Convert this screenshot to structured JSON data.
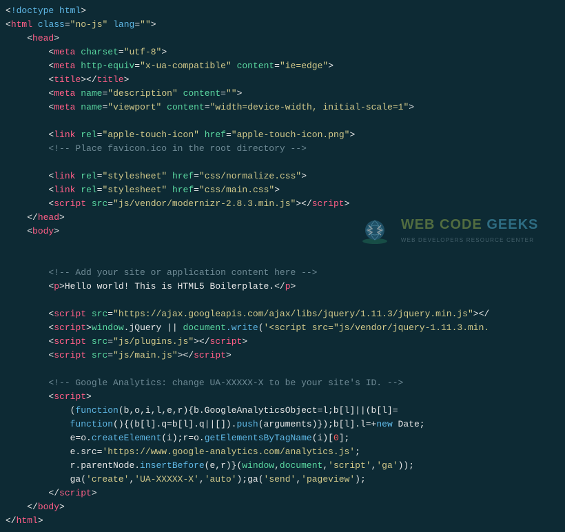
{
  "doctype": "!doctype html",
  "html_open": {
    "tag": "html",
    "cls_attr": "class",
    "cls_val": "no-js",
    "lang_attr": "lang",
    "lang_val": ""
  },
  "head": "head",
  "meta_charset": {
    "tag": "meta",
    "attr": "charset",
    "val": "utf-8"
  },
  "meta_http": {
    "tag": "meta",
    "a1": "http-equiv",
    "v1": "x-ua-compatible",
    "a2": "content",
    "v2": "ie=edge"
  },
  "title_tag": "title",
  "meta_desc": {
    "tag": "meta",
    "a1": "name",
    "v1": "description",
    "a2": "content",
    "v2": ""
  },
  "meta_vp": {
    "tag": "meta",
    "a1": "name",
    "v1": "viewport",
    "a2": "content",
    "v2": "width=device-width, initial-scale=1"
  },
  "link_touch": {
    "tag": "link",
    "a1": "rel",
    "v1": "apple-touch-icon",
    "a2": "href",
    "v2": "apple-touch-icon.png"
  },
  "cmt_favicon": "<!-- Place favicon.ico in the root directory -->",
  "link_norm": {
    "tag": "link",
    "a1": "rel",
    "v1": "stylesheet",
    "a2": "href",
    "v2": "css/normalize.css"
  },
  "link_main": {
    "tag": "link",
    "a1": "rel",
    "v1": "stylesheet",
    "a2": "href",
    "v2": "css/main.css"
  },
  "script_modernizr": {
    "tag": "script",
    "a1": "src",
    "v1": "js/vendor/modernizr-2.8.3.min.js"
  },
  "body": "body",
  "cmt_content": "<!-- Add your site or application content here -->",
  "p": {
    "tag": "p",
    "text": "Hello world! This is HTML5 Boilerplate."
  },
  "script_jq_cdn": {
    "tag": "script",
    "a1": "src",
    "v1": "https://ajax.googleapis.com/ajax/libs/jquery/1.11.3/jquery.min.js"
  },
  "script_jq_fallback": {
    "tag": "script",
    "window": "window",
    "jq": ".jQuery || ",
    "doc": "document",
    "write": ".write",
    "arg": "'<script src=\"js/vendor/jquery-1.11.3.min."
  },
  "script_plugins": {
    "tag": "script",
    "a1": "src",
    "v1": "js/plugins.js"
  },
  "script_main": {
    "tag": "script",
    "a1": "src",
    "v1": "js/main.js"
  },
  "cmt_ga": "<!-- Google Analytics: change UA-XXXXX-X to be your site's ID. -->",
  "ga": {
    "l1a": "(",
    "l1_fn": "function",
    "l1b": "(b,o,i,l,e,r){b.GoogleAnalyticsObject=l;b[l]||(b[l]=",
    "l2_fn": "function",
    "l2a": "(){(b[l].q=b[l].q||[]).",
    "l2_push": "push",
    "l2b": "(arguments)});b[l].l=+",
    "l2_new": "new",
    "l2c": " Date;",
    "l3a": "e=o.",
    "l3_ce": "createElement",
    "l3b": "(i);r=o.",
    "l3_ge": "getElementsByTagName",
    "l3c": "(i)[",
    "l3_zero": "0",
    "l3d": "];",
    "l4a": "e.src=",
    "l4_url": "'https://www.google-analytics.com/analytics.js'",
    "l4b": ";",
    "l5a": "r.parentNode.",
    "l5_ib": "insertBefore",
    "l5b": "(e,r)}(",
    "l5_w": "window",
    "l5c": ",",
    "l5_d": "document",
    "l5d": ",",
    "l5_s1": "'script'",
    "l5e": ",",
    "l5_s2": "'ga'",
    "l5f": "));",
    "l6a": "ga(",
    "l6_s1": "'create'",
    "l6b": ",",
    "l6_s2": "'UA-XXXXX-X'",
    "l6c": ",",
    "l6_s3": "'auto'",
    "l6d": ");ga(",
    "l6_s4": "'send'",
    "l6e": ",",
    "l6_s5": "'pageview'",
    "l6f": ");"
  },
  "watermark": {
    "title1": "WEB CODE ",
    "title2": "GEEKS",
    "sub": "WEB DEVELOPERS RESOURCE CENTER"
  }
}
